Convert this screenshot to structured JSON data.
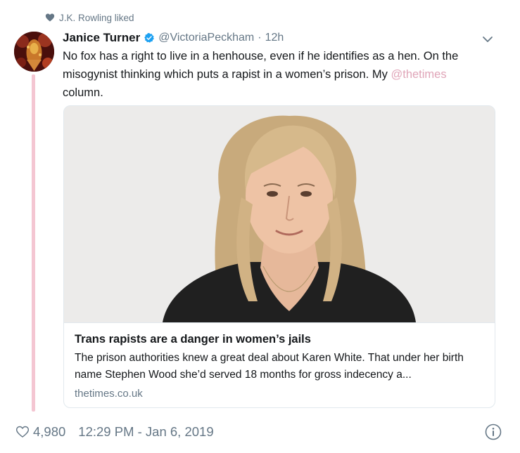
{
  "context": {
    "icon": "heart-icon",
    "text": "J.K. Rowling liked"
  },
  "tweet": {
    "author_name": "Janice Turner",
    "verified": true,
    "handle": "@VictoriaPeckham",
    "separator": "·",
    "time_ago": "12h",
    "text_main": "No fox has a right to live in a henhouse, even if he identifies as a hen. On the misogynist thinking which puts a rapist in a women’s prison. My ",
    "mention": "@thetimes",
    "text_end": " column."
  },
  "card": {
    "title": "Trans rapists are a danger in women’s jails",
    "description": "The prison authorities knew a great deal about Karen White. That under her birth name Stephen Wood she’d served 18 months for gross indecency a...",
    "domain": "thetimes.co.uk"
  },
  "footer": {
    "like_count": "4,980",
    "timestamp": "12:29 PM - Jan 6, 2019"
  },
  "colors": {
    "text": "#14171a",
    "muted": "#657786",
    "mention": "#e0a5b8",
    "thread_line": "#f4c6d2",
    "verified": "#1da1f2",
    "border": "#e1e8ed"
  }
}
